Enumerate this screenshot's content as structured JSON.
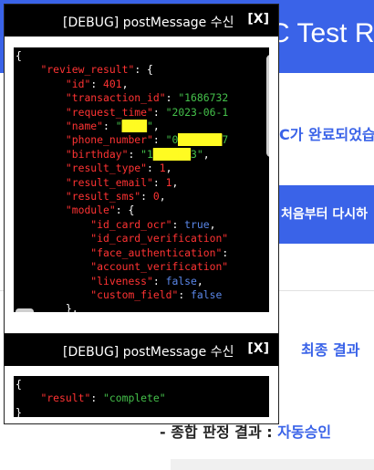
{
  "background": {
    "header_title": "C Test R",
    "message": "C가 완료되었습",
    "restart_button": "처음부터 다시하",
    "final_result_label": "최종 결과",
    "verdict_label": "- 종합 판정 결과 : ",
    "verdict_value": "자동승인"
  },
  "debug_panel_1": {
    "title": "[DEBUG] postMessage 수신",
    "close_label": "[X]",
    "json_lines": [
      [
        [
          "p",
          "{"
        ]
      ],
      [
        [
          "p",
          "    "
        ],
        [
          "k",
          "\"review_result\""
        ],
        [
          "p",
          ": {"
        ]
      ],
      [
        [
          "p",
          "        "
        ],
        [
          "k",
          "\"id\""
        ],
        [
          "p",
          ": "
        ],
        [
          "n",
          "401"
        ],
        [
          "p",
          ","
        ]
      ],
      [
        [
          "p",
          "        "
        ],
        [
          "k",
          "\"transaction_id\""
        ],
        [
          "p",
          ": "
        ],
        [
          "s",
          "\"1686732"
        ]
      ],
      [
        [
          "p",
          "        "
        ],
        [
          "k",
          "\"request_time\""
        ],
        [
          "p",
          ": "
        ],
        [
          "s",
          "\"2023-06-1"
        ]
      ],
      [
        [
          "p",
          "        "
        ],
        [
          "k",
          "\"name\""
        ],
        [
          "p",
          ": "
        ],
        [
          "s",
          "\""
        ],
        [
          "r",
          "████"
        ],
        [
          "s",
          "\""
        ],
        [
          "p",
          ","
        ]
      ],
      [
        [
          "p",
          "        "
        ],
        [
          "k",
          "\"phone_number\""
        ],
        [
          "p",
          ": "
        ],
        [
          "s",
          "\"0"
        ],
        [
          "r",
          "███████"
        ],
        [
          "s",
          "7"
        ]
      ],
      [
        [
          "p",
          "        "
        ],
        [
          "k",
          "\"birthday\""
        ],
        [
          "p",
          ": "
        ],
        [
          "s",
          "\"1"
        ],
        [
          "r",
          "██████"
        ],
        [
          "s",
          "3\""
        ],
        [
          "p",
          ","
        ]
      ],
      [
        [
          "p",
          "        "
        ],
        [
          "k",
          "\"result_type\""
        ],
        [
          "p",
          ": "
        ],
        [
          "n",
          "1"
        ],
        [
          "p",
          ","
        ]
      ],
      [
        [
          "p",
          "        "
        ],
        [
          "k",
          "\"result_email\""
        ],
        [
          "p",
          ": "
        ],
        [
          "n",
          "1"
        ],
        [
          "p",
          ","
        ]
      ],
      [
        [
          "p",
          "        "
        ],
        [
          "k",
          "\"result_sms\""
        ],
        [
          "p",
          ": "
        ],
        [
          "n",
          "0"
        ],
        [
          "p",
          ","
        ]
      ],
      [
        [
          "p",
          "        "
        ],
        [
          "k",
          "\"module\""
        ],
        [
          "p",
          ": {"
        ]
      ],
      [
        [
          "p",
          "            "
        ],
        [
          "k",
          "\"id_card_ocr\""
        ],
        [
          "p",
          ": "
        ],
        [
          "b",
          "true"
        ],
        [
          "p",
          ","
        ]
      ],
      [
        [
          "p",
          "            "
        ],
        [
          "k",
          "\"id_card_verification\""
        ]
      ],
      [
        [
          "p",
          "            "
        ],
        [
          "k",
          "\"face_authentication\""
        ],
        [
          "p",
          ":"
        ]
      ],
      [
        [
          "p",
          "            "
        ],
        [
          "k",
          "\"account_verification\""
        ]
      ],
      [
        [
          "p",
          "            "
        ],
        [
          "k",
          "\"liveness\""
        ],
        [
          "p",
          ": "
        ],
        [
          "b",
          "false"
        ],
        [
          "p",
          ","
        ]
      ],
      [
        [
          "p",
          "            "
        ],
        [
          "k",
          "\"custom_field\""
        ],
        [
          "p",
          ": "
        ],
        [
          "b",
          "false"
        ]
      ],
      [
        [
          "p",
          "        },"
        ]
      ]
    ]
  },
  "debug_panel_2": {
    "title": "[DEBUG] postMessage 수신",
    "close_label": "[X]",
    "json_lines": [
      [
        [
          "p",
          "{"
        ]
      ],
      [
        [
          "p",
          "    "
        ],
        [
          "k",
          "\"result\""
        ],
        [
          "p",
          ": "
        ],
        [
          "s",
          "\"complete\""
        ]
      ],
      [
        [
          "p",
          "}"
        ]
      ]
    ]
  }
}
